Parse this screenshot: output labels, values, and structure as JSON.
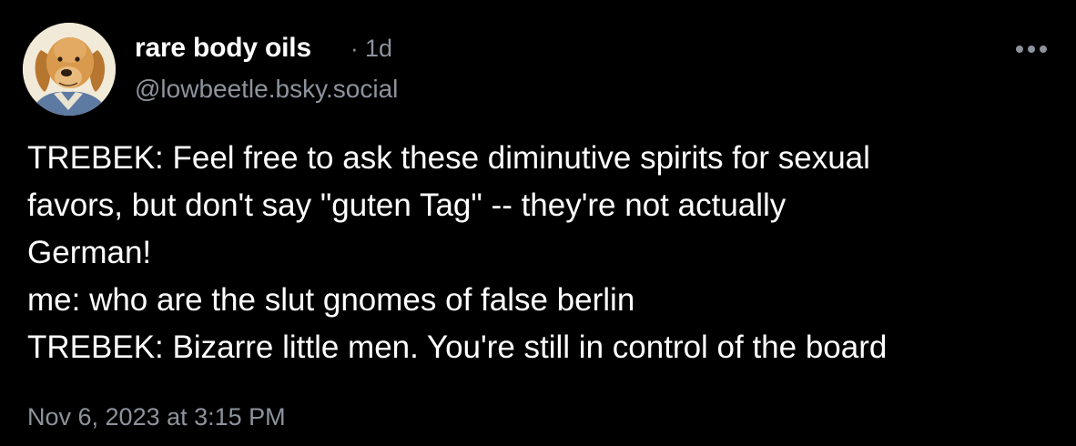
{
  "post": {
    "author": {
      "display_name": "rare body oils",
      "handle": "@lowbeetle.bsky.social",
      "avatar_icon": "golden-retriever-avatar"
    },
    "separator": "·",
    "age": "1d",
    "more_icon": "more-horizontal-icon",
    "text_lines": [
      "TREBEK: Feel free to ask these diminutive spirits for sexual",
      "favors, but don't say \"guten Tag\" -- they're not actually",
      "German!",
      "me: who are the slut gnomes of false berlin",
      "TREBEK: Bizarre little men. You're still in control of the board"
    ],
    "timestamp": "Nov 6, 2023 at 3:15 PM"
  },
  "colors": {
    "background": "#000000",
    "primary_text": "#ffffff",
    "secondary_text": "#8d939c"
  }
}
